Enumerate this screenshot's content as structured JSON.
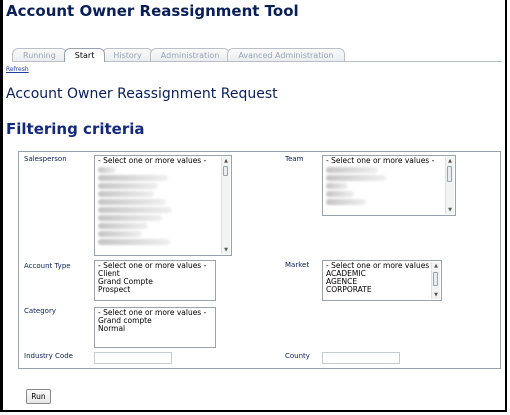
{
  "app": {
    "title": "Account Owner Reassignment Tool"
  },
  "tabs": [
    {
      "label": "Running",
      "active": false
    },
    {
      "label": "Start",
      "active": true
    },
    {
      "label": "History",
      "active": false
    },
    {
      "label": "Administration",
      "active": false
    },
    {
      "label": "Avanced Administration",
      "active": false
    }
  ],
  "refresh_link": "Refresh",
  "page_title": "Account Owner Reassignment Request",
  "section_title": "Filtering criteria",
  "filters": {
    "salesperson": {
      "label": "Salesperson",
      "placeholder": "- Select one or more values -"
    },
    "team": {
      "label": "Team",
      "placeholder": "- Select one or more values -"
    },
    "account_type": {
      "label": "Account Type",
      "options": [
        "- Select one or more values -",
        "Client",
        "Grand Compte",
        "Prospect"
      ]
    },
    "market": {
      "label": "Market",
      "options": [
        "- Select one or more values -",
        "ACADEMIC",
        "AGENCE",
        "CORPORATE"
      ]
    },
    "category": {
      "label": "Category",
      "options": [
        "- Select one or more values -",
        "Grand compte",
        "Normal"
      ]
    },
    "industry_code": {
      "label": "Industry Code",
      "value": ""
    },
    "county": {
      "label": "County",
      "value": ""
    }
  },
  "run_button": "Run",
  "colors": {
    "title": "#0a1f56",
    "link": "#1c3fa6",
    "border": "#9aa2ad"
  }
}
